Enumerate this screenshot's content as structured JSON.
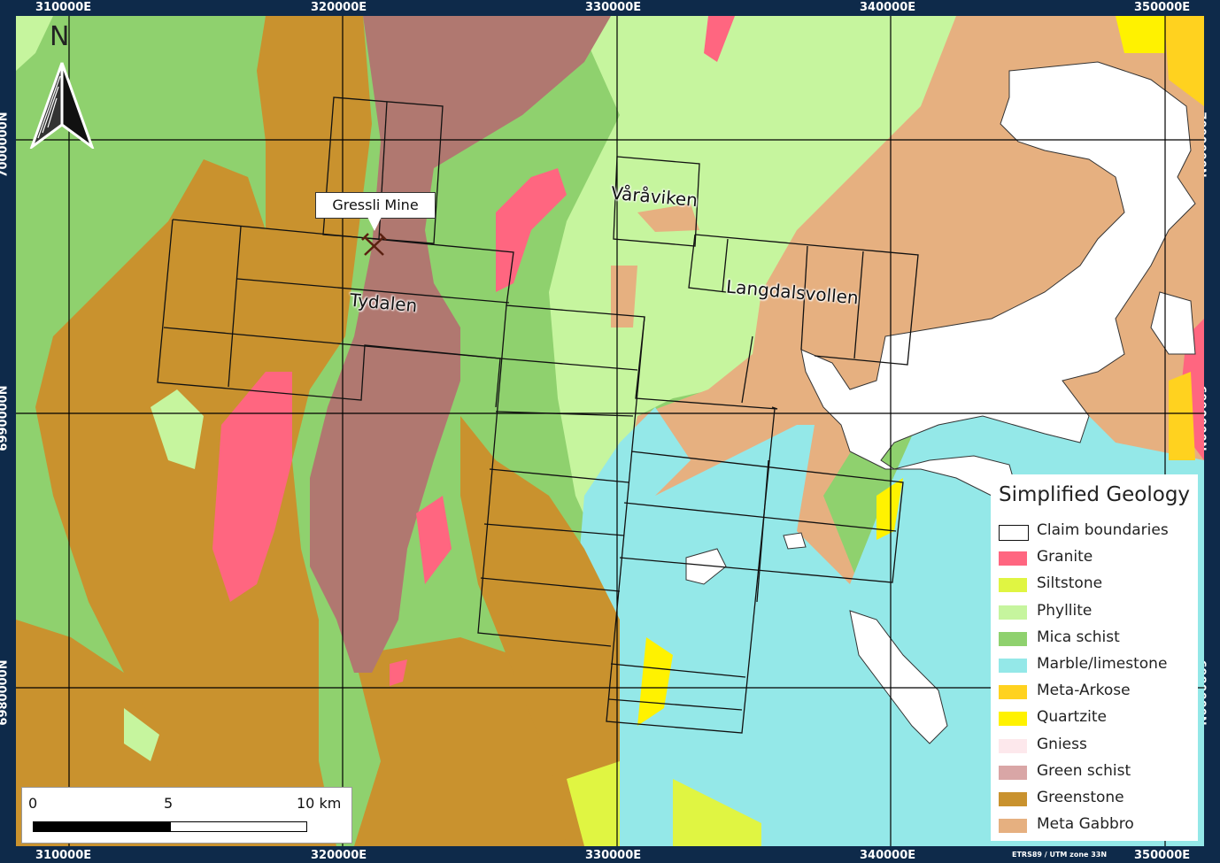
{
  "coords": {
    "top": [
      "310000E",
      "320000E",
      "330000E",
      "340000E",
      "350000E"
    ],
    "bottom": [
      "310000E",
      "320000E",
      "330000E",
      "340000E",
      "350000E"
    ],
    "left": [
      "7000000N",
      "6990000N",
      "6980000N"
    ],
    "right": [
      "7000000N",
      "6990000N",
      "6980000N"
    ]
  },
  "credit": "ETRS89 / UTM zone 33N",
  "north_label": "N",
  "labels": {
    "mine": "Gressli Mine",
    "tydalen": "Tydalen",
    "varaviken": "Våråviken",
    "langdalsvollen": "Langdalsvollen"
  },
  "scale": {
    "zero": "0",
    "mid": "5",
    "end": "10 km"
  },
  "legend": {
    "title": "Simplified Geology",
    "items": [
      {
        "label": "Claim boundaries",
        "color": "#ffffff"
      },
      {
        "label": "Granite",
        "color": "#ff6680"
      },
      {
        "label": "Siltstone",
        "color": "#e0f542"
      },
      {
        "label": "Phyllite",
        "color": "#c6f59e"
      },
      {
        "label": "Mica schist",
        "color": "#8fd16e"
      },
      {
        "label": "Marble/limestone",
        "color": "#94e8e8"
      },
      {
        "label": "Meta-Arkose",
        "color": "#ffd21f"
      },
      {
        "label": "Quartzite",
        "color": "#fff200"
      },
      {
        "label": "Gniess",
        "color": "#fde8ec"
      },
      {
        "label": "Green schist",
        "color": "#d9a6a6"
      },
      {
        "label": "Greenstone",
        "color": "#c9922e"
      },
      {
        "label": "Meta Gabbro",
        "color": "#e6b080"
      }
    ]
  },
  "colors": {
    "mica_schist": "#8fd16e",
    "phyllite": "#c6f59e",
    "greenstone": "#c9922e",
    "meta_gabbro": "#e6b080",
    "marble": "#94e8e8",
    "granite": "#ff6680",
    "quartzite": "#fff200",
    "meta_arkose": "#ffd21f",
    "siltstone": "#e0f542",
    "mauve": "#b07870",
    "water": "#ffffff",
    "frame": "#0e2a4a"
  }
}
